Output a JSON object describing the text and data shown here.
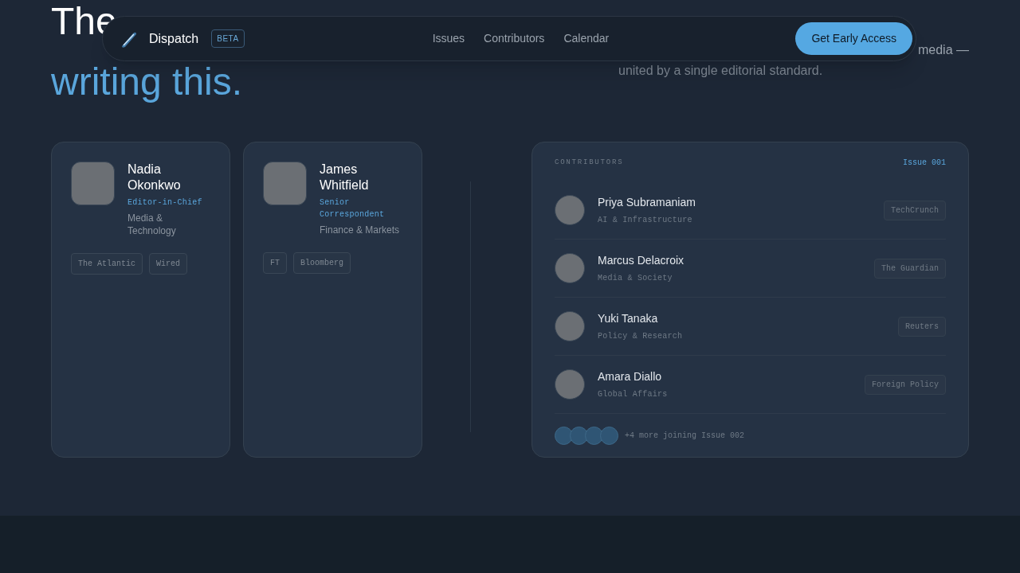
{
  "nav": {
    "brand": "Dispatch",
    "badge": "BETA",
    "links": [
      "Issues",
      "Contributors",
      "Calendar"
    ],
    "cta": "Get Early Access"
  },
  "hero": {
    "heading": [
      {
        "text": "The",
        "accent": false
      },
      {
        "text": "writing this.",
        "accent": true
      }
    ],
    "intro": [
      "media —",
      "united by a single editorial standard."
    ]
  },
  "featured": [
    {
      "name": "Nadia Okonkwo",
      "role": "Editor-in-Chief",
      "beat": "Media & Technology",
      "outlets": [
        "The Atlantic",
        "Wired"
      ]
    },
    {
      "name": "James Whitfield",
      "role": "Senior Correspondent",
      "beat": "Finance & Markets",
      "outlets": [
        "FT",
        "Bloomberg"
      ]
    }
  ],
  "contributors": {
    "label": "CONTRIBUTORS",
    "issue": "Issue 001",
    "rows": [
      {
        "name": "Priya Subramaniam",
        "beat": "AI & Infrastructure",
        "outlet": "TechCrunch"
      },
      {
        "name": "Marcus Delacroix",
        "beat": "Media & Society",
        "outlet": "The Guardian"
      },
      {
        "name": "Yuki Tanaka",
        "beat": "Policy & Research",
        "outlet": "Reuters"
      },
      {
        "name": "Amara Diallo",
        "beat": "Global Affairs",
        "outlet": "Foreign Policy"
      }
    ],
    "more": "+4 more joining Issue 002"
  }
}
